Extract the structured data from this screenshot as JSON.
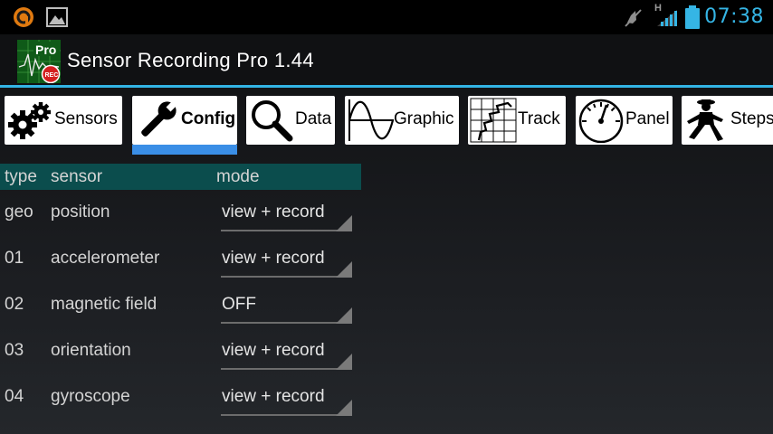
{
  "status_bar": {
    "time": "07:38",
    "network_type": "H",
    "icons": [
      "avast-icon",
      "gallery-icon",
      "mute-icon",
      "signal-icon",
      "battery-icon"
    ]
  },
  "action_bar": {
    "title": "Sensor Recording Pro 1.44",
    "app_icon_badge": "Pro",
    "app_icon_rec": "REC"
  },
  "tabs": [
    {
      "label": "Sensors",
      "icon": "gears-icon"
    },
    {
      "label": "Config",
      "icon": "wrench-icon",
      "active": true
    },
    {
      "label": "Data",
      "icon": "magnifier-icon"
    },
    {
      "label": "Graphic",
      "icon": "sine-wave-icon"
    },
    {
      "label": "Track",
      "icon": "map-track-icon"
    },
    {
      "label": "Panel",
      "icon": "gauge-icon"
    },
    {
      "label": "Steps",
      "icon": "walking-man-icon"
    }
  ],
  "table": {
    "headers": {
      "type": "type",
      "sensor": "sensor",
      "mode": "mode"
    },
    "rows": [
      {
        "type": "geo",
        "sensor": "position",
        "mode": "view + record"
      },
      {
        "type": "01",
        "sensor": "accelerometer",
        "mode": "view + record"
      },
      {
        "type": "02",
        "sensor": "magnetic field",
        "mode": "OFF"
      },
      {
        "type": "03",
        "sensor": "orientation",
        "mode": "view + record"
      },
      {
        "type": "04",
        "sensor": "gyroscope",
        "mode": "view + record"
      }
    ]
  },
  "colors": {
    "accent": "#33b5e5",
    "clock": "#35b5e5",
    "tab_indicator": "#3a8ee6",
    "table_header": "#0b4d4d"
  }
}
